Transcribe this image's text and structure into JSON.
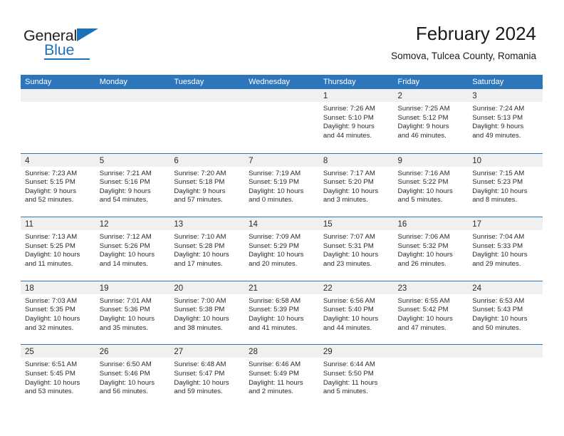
{
  "brand": {
    "word_one": "General",
    "word_two": "Blue",
    "accent_color": "#1d71b8"
  },
  "header": {
    "title": "February 2024",
    "subtitle": "Somova, Tulcea County, Romania"
  },
  "theme": {
    "header_blue": "#2e76bc",
    "day_strip_gray": "#f0f0f0",
    "text": "#2a2a2a"
  },
  "weekdays": [
    "Sunday",
    "Monday",
    "Tuesday",
    "Wednesday",
    "Thursday",
    "Friday",
    "Saturday"
  ],
  "weeks": [
    [
      {
        "day": "",
        "lines": []
      },
      {
        "day": "",
        "lines": []
      },
      {
        "day": "",
        "lines": []
      },
      {
        "day": "",
        "lines": []
      },
      {
        "day": "1",
        "lines": [
          "Sunrise: 7:26 AM",
          "Sunset: 5:10 PM",
          "Daylight: 9 hours",
          "and 44 minutes."
        ]
      },
      {
        "day": "2",
        "lines": [
          "Sunrise: 7:25 AM",
          "Sunset: 5:12 PM",
          "Daylight: 9 hours",
          "and 46 minutes."
        ]
      },
      {
        "day": "3",
        "lines": [
          "Sunrise: 7:24 AM",
          "Sunset: 5:13 PM",
          "Daylight: 9 hours",
          "and 49 minutes."
        ]
      }
    ],
    [
      {
        "day": "4",
        "lines": [
          "Sunrise: 7:23 AM",
          "Sunset: 5:15 PM",
          "Daylight: 9 hours",
          "and 52 minutes."
        ]
      },
      {
        "day": "5",
        "lines": [
          "Sunrise: 7:21 AM",
          "Sunset: 5:16 PM",
          "Daylight: 9 hours",
          "and 54 minutes."
        ]
      },
      {
        "day": "6",
        "lines": [
          "Sunrise: 7:20 AM",
          "Sunset: 5:18 PM",
          "Daylight: 9 hours",
          "and 57 minutes."
        ]
      },
      {
        "day": "7",
        "lines": [
          "Sunrise: 7:19 AM",
          "Sunset: 5:19 PM",
          "Daylight: 10 hours",
          "and 0 minutes."
        ]
      },
      {
        "day": "8",
        "lines": [
          "Sunrise: 7:17 AM",
          "Sunset: 5:20 PM",
          "Daylight: 10 hours",
          "and 3 minutes."
        ]
      },
      {
        "day": "9",
        "lines": [
          "Sunrise: 7:16 AM",
          "Sunset: 5:22 PM",
          "Daylight: 10 hours",
          "and 5 minutes."
        ]
      },
      {
        "day": "10",
        "lines": [
          "Sunrise: 7:15 AM",
          "Sunset: 5:23 PM",
          "Daylight: 10 hours",
          "and 8 minutes."
        ]
      }
    ],
    [
      {
        "day": "11",
        "lines": [
          "Sunrise: 7:13 AM",
          "Sunset: 5:25 PM",
          "Daylight: 10 hours",
          "and 11 minutes."
        ]
      },
      {
        "day": "12",
        "lines": [
          "Sunrise: 7:12 AM",
          "Sunset: 5:26 PM",
          "Daylight: 10 hours",
          "and 14 minutes."
        ]
      },
      {
        "day": "13",
        "lines": [
          "Sunrise: 7:10 AM",
          "Sunset: 5:28 PM",
          "Daylight: 10 hours",
          "and 17 minutes."
        ]
      },
      {
        "day": "14",
        "lines": [
          "Sunrise: 7:09 AM",
          "Sunset: 5:29 PM",
          "Daylight: 10 hours",
          "and 20 minutes."
        ]
      },
      {
        "day": "15",
        "lines": [
          "Sunrise: 7:07 AM",
          "Sunset: 5:31 PM",
          "Daylight: 10 hours",
          "and 23 minutes."
        ]
      },
      {
        "day": "16",
        "lines": [
          "Sunrise: 7:06 AM",
          "Sunset: 5:32 PM",
          "Daylight: 10 hours",
          "and 26 minutes."
        ]
      },
      {
        "day": "17",
        "lines": [
          "Sunrise: 7:04 AM",
          "Sunset: 5:33 PM",
          "Daylight: 10 hours",
          "and 29 minutes."
        ]
      }
    ],
    [
      {
        "day": "18",
        "lines": [
          "Sunrise: 7:03 AM",
          "Sunset: 5:35 PM",
          "Daylight: 10 hours",
          "and 32 minutes."
        ]
      },
      {
        "day": "19",
        "lines": [
          "Sunrise: 7:01 AM",
          "Sunset: 5:36 PM",
          "Daylight: 10 hours",
          "and 35 minutes."
        ]
      },
      {
        "day": "20",
        "lines": [
          "Sunrise: 7:00 AM",
          "Sunset: 5:38 PM",
          "Daylight: 10 hours",
          "and 38 minutes."
        ]
      },
      {
        "day": "21",
        "lines": [
          "Sunrise: 6:58 AM",
          "Sunset: 5:39 PM",
          "Daylight: 10 hours",
          "and 41 minutes."
        ]
      },
      {
        "day": "22",
        "lines": [
          "Sunrise: 6:56 AM",
          "Sunset: 5:40 PM",
          "Daylight: 10 hours",
          "and 44 minutes."
        ]
      },
      {
        "day": "23",
        "lines": [
          "Sunrise: 6:55 AM",
          "Sunset: 5:42 PM",
          "Daylight: 10 hours",
          "and 47 minutes."
        ]
      },
      {
        "day": "24",
        "lines": [
          "Sunrise: 6:53 AM",
          "Sunset: 5:43 PM",
          "Daylight: 10 hours",
          "and 50 minutes."
        ]
      }
    ],
    [
      {
        "day": "25",
        "lines": [
          "Sunrise: 6:51 AM",
          "Sunset: 5:45 PM",
          "Daylight: 10 hours",
          "and 53 minutes."
        ]
      },
      {
        "day": "26",
        "lines": [
          "Sunrise: 6:50 AM",
          "Sunset: 5:46 PM",
          "Daylight: 10 hours",
          "and 56 minutes."
        ]
      },
      {
        "day": "27",
        "lines": [
          "Sunrise: 6:48 AM",
          "Sunset: 5:47 PM",
          "Daylight: 10 hours",
          "and 59 minutes."
        ]
      },
      {
        "day": "28",
        "lines": [
          "Sunrise: 6:46 AM",
          "Sunset: 5:49 PM",
          "Daylight: 11 hours",
          "and 2 minutes."
        ]
      },
      {
        "day": "29",
        "lines": [
          "Sunrise: 6:44 AM",
          "Sunset: 5:50 PM",
          "Daylight: 11 hours",
          "and 5 minutes."
        ]
      },
      {
        "day": "",
        "lines": []
      },
      {
        "day": "",
        "lines": []
      }
    ]
  ]
}
